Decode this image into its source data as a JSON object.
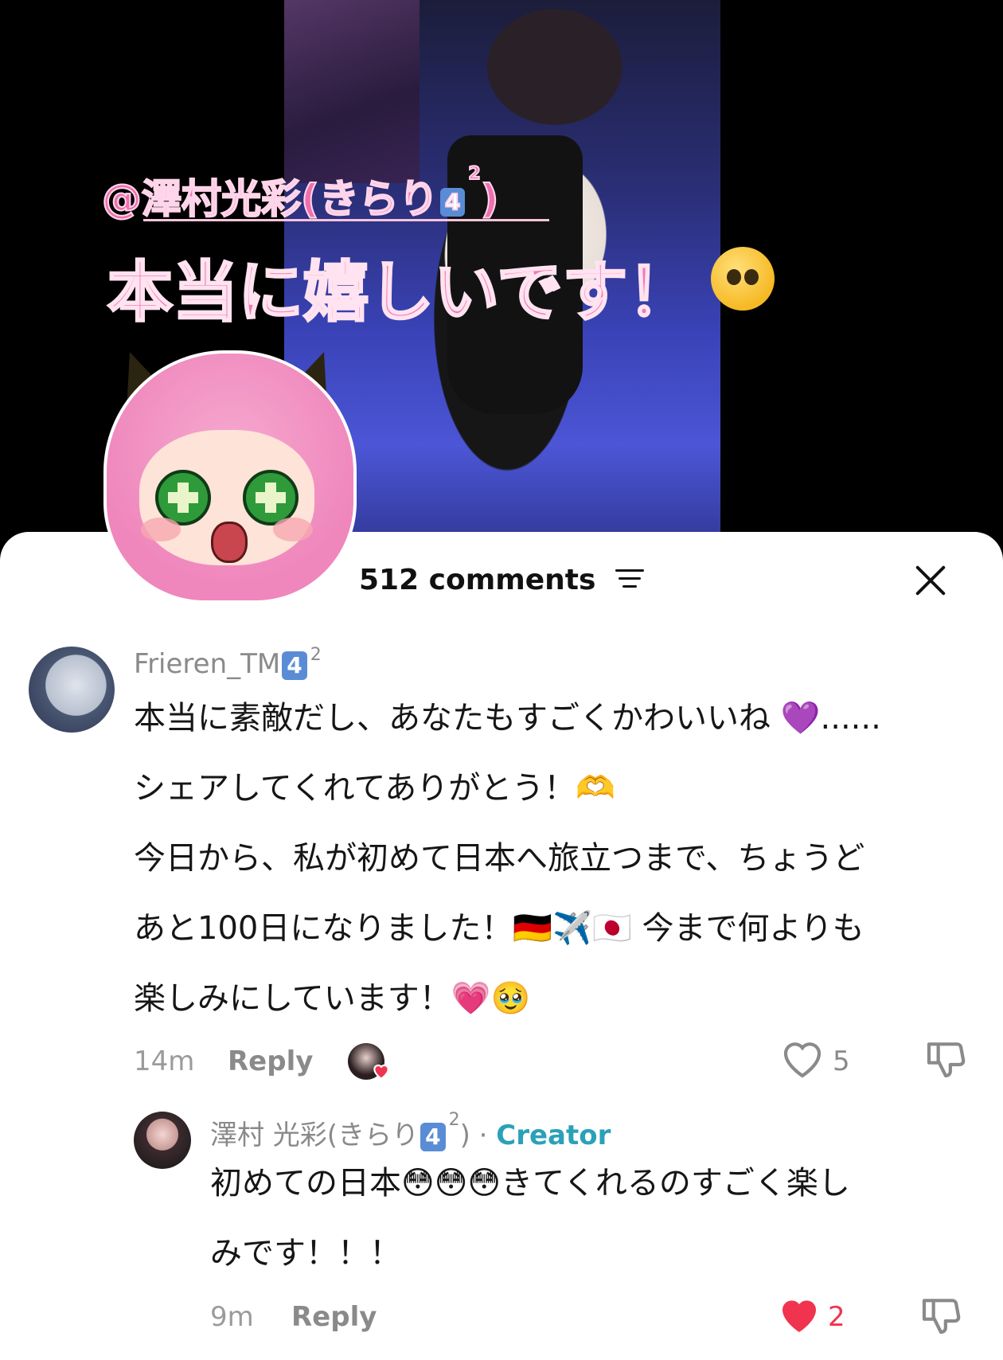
{
  "video": {
    "mention": "@澤村光彩(きらり",
    "mention_key": "4",
    "mention_sup": "2",
    "mention_close": ")",
    "caption": "本当に嬉しいです！"
  },
  "comments_header": {
    "count_label": "512 comments"
  },
  "comments": [
    {
      "username": "Frieren_TM",
      "username_key": "4",
      "username_sup": "2",
      "lines": [
        "本当に素敵だし、あなたもすごくかわいいね 💜......",
        "シェアしてくれてありがとう！🫶",
        "今日から、私が初めて日本へ旅立つまで、ちょうど",
        "あと100日になりました！🇩🇪✈️🇯🇵 今まで何よりも",
        "楽しみにしています！💗🥹"
      ],
      "time": "14m",
      "reply_label": "Reply",
      "likes": "5"
    },
    {
      "username": "澤村 光彩(きらり",
      "username_key": "4",
      "username_sup": "2",
      "username_close": ")",
      "separator": " · ",
      "badge": "Creator",
      "lines": [
        "初めての日本😳😳😳きてくれるのすごく楽し",
        "みです！！！"
      ],
      "time": "9m",
      "reply_label": "Reply",
      "likes": "2",
      "liked": true
    }
  ],
  "colors": {
    "caption_pink": "#f07ab4",
    "creator_teal": "#2aa1b8",
    "like_red": "#f0344f",
    "keycap_blue": "#5a8cd6"
  }
}
